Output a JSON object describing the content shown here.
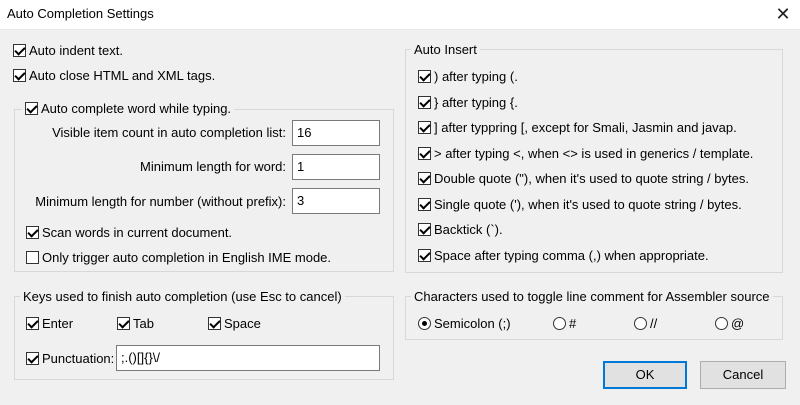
{
  "window": {
    "title": "Auto Completion Settings",
    "close_glyph": "✕"
  },
  "general": {
    "auto_indent": {
      "label": "Auto indent text.",
      "checked": true
    },
    "auto_close_tags": {
      "label": "Auto close HTML and XML tags.",
      "checked": true
    },
    "auto_complete_word": {
      "label": "Auto complete word while typing.",
      "checked": true
    },
    "visible_count": {
      "label": "Visible item count in auto completion list:",
      "value": "16"
    },
    "min_length_word": {
      "label": "Minimum length for word:",
      "value": "1"
    },
    "min_length_number": {
      "label": "Minimum length for number (without prefix):",
      "value": "3"
    },
    "scan_words": {
      "label": "Scan words in current document.",
      "checked": true
    },
    "english_ime_only": {
      "label": "Only trigger auto completion in English IME mode.",
      "checked": false
    }
  },
  "auto_insert": {
    "title": "Auto Insert",
    "items": [
      {
        "label": ") after typing (.",
        "checked": true
      },
      {
        "label": "} after typing {.",
        "checked": true
      },
      {
        "label": "] after typpring [, except for Smali, Jasmin and javap.",
        "checked": true
      },
      {
        "label": "> after typing <, when <> is used in generics / template.",
        "checked": true
      },
      {
        "label": "Double quote (\"), when it's used to quote string / bytes.",
        "checked": true
      },
      {
        "label": "Single quote ('), when it's used to quote string / bytes.",
        "checked": true
      },
      {
        "label": "Backtick (`).",
        "checked": true
      },
      {
        "label": "Space after typing comma (,) when appropriate.",
        "checked": true
      }
    ]
  },
  "finish_keys": {
    "title": "Keys used to finish auto completion (use Esc to cancel)",
    "enter": {
      "label": "Enter",
      "checked": true
    },
    "tab": {
      "label": "Tab",
      "checked": true
    },
    "space": {
      "label": "Space",
      "checked": true
    },
    "punctuation": {
      "label": "Punctuation:",
      "checked": true,
      "value": ";.()[]{}\\/"
    }
  },
  "line_comment": {
    "title": "Characters used to toggle line comment for Assembler source",
    "options": [
      {
        "label": "Semicolon (;)",
        "selected": true
      },
      {
        "label": "#",
        "selected": false
      },
      {
        "label": "//",
        "selected": false
      },
      {
        "label": "@",
        "selected": false
      }
    ]
  },
  "buttons": {
    "ok": "OK",
    "cancel": "Cancel"
  }
}
